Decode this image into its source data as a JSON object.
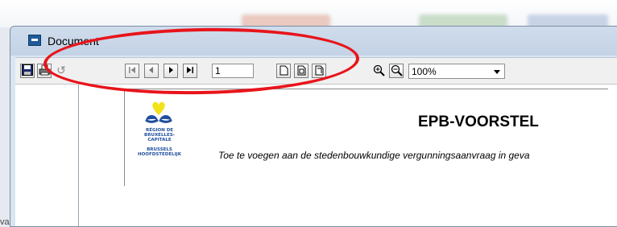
{
  "window": {
    "title": "Document"
  },
  "toolbar": {
    "buttons": [
      {
        "name": "save-button",
        "icon": "floppy-disk-icon"
      },
      {
        "name": "print-button",
        "icon": "printer-icon"
      },
      {
        "name": "refresh-button",
        "icon": "refresh-icon",
        "glyph": "↺"
      },
      {
        "name": "first-page-button",
        "icon": "first-page-icon",
        "glyph": "⏮"
      },
      {
        "name": "previous-page-button",
        "icon": "previous-page-icon",
        "glyph": "◀"
      },
      {
        "name": "next-page-button",
        "icon": "next-page-icon",
        "glyph": "▶"
      },
      {
        "name": "last-page-button",
        "icon": "last-page-icon",
        "glyph": "⏭"
      }
    ],
    "page_number": "1",
    "zoom_value": "100%"
  },
  "document": {
    "logo_line1": "RÉGION DE BRUXELLES-CAPITALE",
    "logo_line2": "BRUSSELS HOOFDSTEDELIJK",
    "title": "EPB-VOORSTEL",
    "subtitle": "Toe te voegen aan de stedenbouwkundige vergunningsaanvraag in geva"
  },
  "left_edge_text": "va",
  "colors": {
    "highlight": "#e8141b",
    "logo_yellow": "#f2e21a",
    "logo_blue": "#1f4e9c"
  }
}
